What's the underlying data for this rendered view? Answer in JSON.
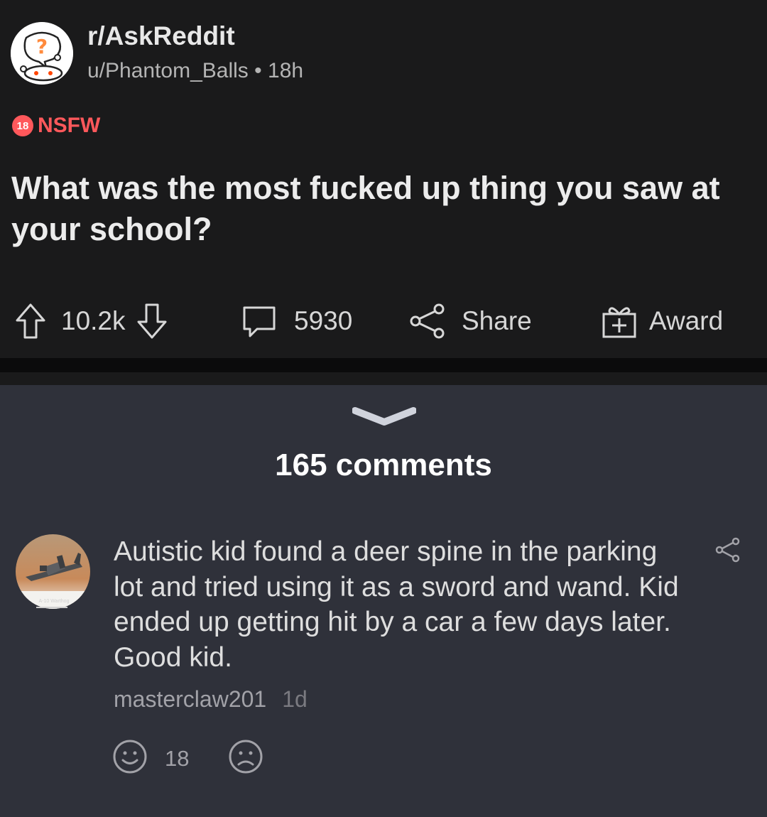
{
  "post": {
    "subreddit": "r/AskReddit",
    "author": "u/Phantom_Balls",
    "separator": "•",
    "age": "18h",
    "nsfw_badge": "18",
    "nsfw_label": "NSFW",
    "title": "What was the most fucked up thing you saw at your school?",
    "actions": {
      "votes": "10.2k",
      "comments": "5930",
      "share": "Share",
      "award": "Award"
    }
  },
  "comments_header": {
    "count_label": "165 comments"
  },
  "comment": {
    "avatar_flair": "A-10 Warthog",
    "body": "Autistic kid found a deer spine in the parking lot and tried using it as a sword and wand. Kid ended up getting hit by a car a few days later. Good kid.",
    "author": "masterclaw201",
    "age": "1d",
    "like_count": "18"
  },
  "colors": {
    "post_bg": "#1a1a1b",
    "comments_bg": "#2f313a",
    "nsfw": "#ff585b",
    "text": "#e8e8e8"
  },
  "icons": [
    "upvote-icon",
    "downvote-icon",
    "comment-icon",
    "share-icon",
    "award-icon",
    "chevron-down-icon",
    "smile-icon",
    "frown-icon",
    "askreddit-logo-icon"
  ]
}
